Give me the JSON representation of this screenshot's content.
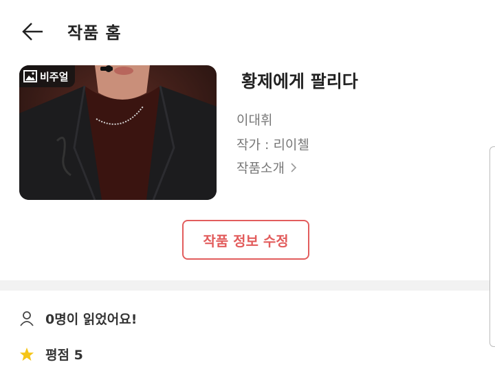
{
  "header": {
    "back_icon": "arrow-left-icon",
    "title": "작품 홈"
  },
  "work": {
    "cover_badge": "비주얼",
    "cover_badge_icon": "image-icon",
    "title": "황제에게 팔리다",
    "author": "이대휘",
    "artist": "작가 : 리이첼",
    "intro_label": "작품소개",
    "intro_icon": "chevron-right-icon"
  },
  "actions": {
    "edit_label": "작품 정보 수정",
    "accent_color": "#e25c5c"
  },
  "stats": {
    "readers_text": "0명이 읽었어요!",
    "readers_icon": "person-icon",
    "rating_text": "평점 5",
    "rating_icon": "star-icon",
    "star_color": "#f5c518"
  }
}
